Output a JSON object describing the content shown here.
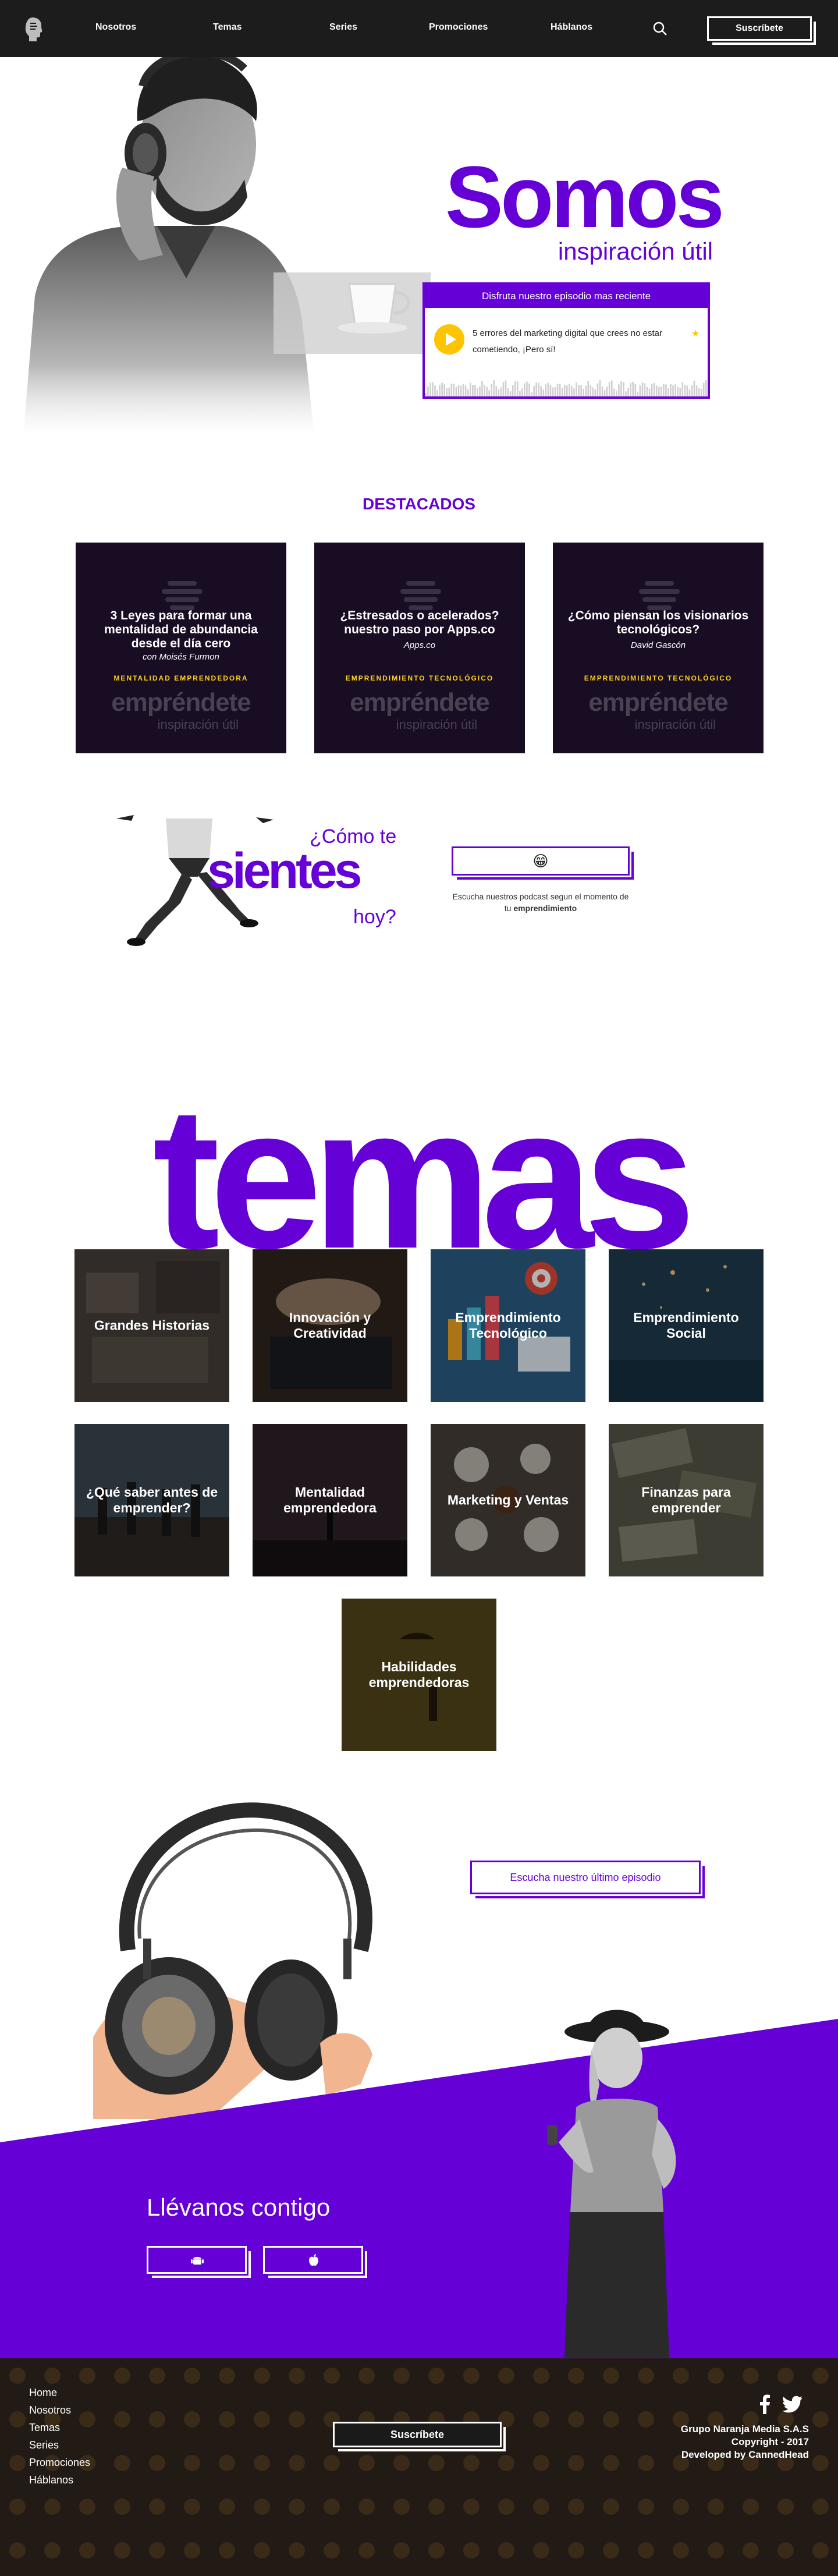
{
  "nav": {
    "links": [
      "Nosotros",
      "Temas",
      "Series",
      "Promociones",
      "Háblanos"
    ],
    "subscribe": "Suscríbete",
    "logo_icon": "head-silhouette-icon",
    "search_icon": "search-icon"
  },
  "hero": {
    "title": "Somos",
    "subtitle": "inspiración útil",
    "player_heading": "Disfruta nuestro episodio mas reciente",
    "player_episode": "5 errores del marketing digital que crees no estar cometiendo, ¡Pero sí!",
    "player_star": "★",
    "colors": {
      "accent": "#6500d6",
      "play": "#ffc400"
    }
  },
  "destacados": {
    "title": "DESTACADOS",
    "cards": [
      {
        "title": "3 Leyes para formar una mentalidad de abundancia desde el día cero",
        "author": "con Moisés Furmon",
        "tag": "MENTALIDAD EMPRENDEDORA"
      },
      {
        "title": "¿Estresados o acelerados? nuestro paso por Apps.co",
        "author": "Apps.co",
        "tag": "EMPRENDIMIENTO TECNOLÓGICO"
      },
      {
        "title": "¿Cómo piensan los visionarios tecnológicos?",
        "author": "David Gascón",
        "tag": "EMPRENDIMIENTO TECNOLÓGICO"
      }
    ],
    "brand": "empréndete",
    "brand_sub": "inspiración útil"
  },
  "mood": {
    "q1": "¿Cómo te",
    "big": "sientes",
    "q2": "hoy?",
    "selected_emoji": "😁",
    "note_prefix": "Escucha nuestros podcast segun el momento de tu",
    "note_bold": "emprendimiento"
  },
  "temas": {
    "title": "temas",
    "tiles": [
      {
        "label": "Grandes Historias"
      },
      {
        "label": "Innovación y Creatividad"
      },
      {
        "label": "Emprendimiento Tecnológico"
      },
      {
        "label": "Emprendimiento Social"
      },
      {
        "label": "¿Qué saber antes de emprender?"
      },
      {
        "label": "Mentalidad emprendedora"
      },
      {
        "label": "Marketing y Ventas"
      },
      {
        "label": "Finanzas para emprender"
      },
      {
        "label": "Habilidades emprendedoras"
      }
    ]
  },
  "promo": {
    "link": "Escucha nuestro último episodio",
    "title": "Llévanos contigo",
    "stores": [
      "android-icon",
      "apple-icon"
    ]
  },
  "footer": {
    "links": [
      "Home",
      "Nosotros",
      "Temas",
      "Series",
      "Promociones",
      "Háblanos"
    ],
    "subscribe": "Suscríbete",
    "social": [
      "facebook-icon",
      "twitter-icon"
    ],
    "credits": [
      "Grupo Naranja Media S.A.S",
      "Copyright - 2017",
      "Developed by CannedHead"
    ]
  }
}
